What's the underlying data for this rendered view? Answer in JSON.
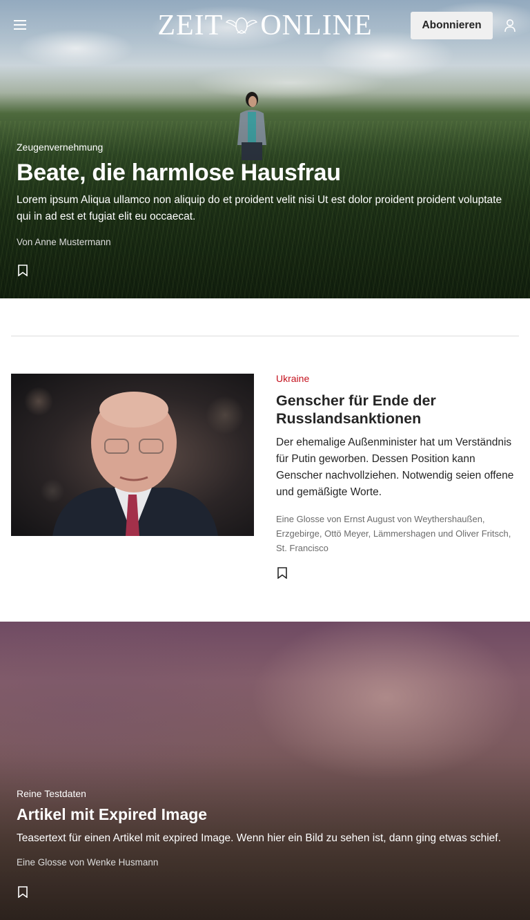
{
  "header": {
    "logo_left": "ZEIT",
    "logo_right": "ONLINE",
    "subscribe_label": "Abonnieren",
    "menu_icon": "hamburger-menu-icon",
    "account_icon": "user-account-icon"
  },
  "teasers": [
    {
      "kicker": "Zeugenvernehmung",
      "title": "Beate, die harmlose Hausfrau",
      "text": "Lorem ipsum Aliqua ullamco non aliquip do et proident velit nisi Ut est dolor proident proident voluptate qui in ad est et fugiat elit eu occaecat.",
      "byline": "Von Anne Mustermann",
      "bookmark_icon": "bookmark-icon"
    },
    {
      "kicker": "Ukraine",
      "title": "Genscher für Ende der Russlandsanktionen",
      "text": "Der ehemalige Außenminister hat um Verständnis für Putin geworben. Dessen Position kann Genscher nachvollziehen. Notwendig seien offene und gemäßigte Worte.",
      "byline": "Eine Glosse von Ernst August von Weythershaußen, Erzgebirge, Ottö Meyer, Lämmershagen und Oliver Fritsch, St. Francisco",
      "bookmark_icon": "bookmark-icon"
    },
    {
      "kicker": "Reine Testdaten",
      "title": "Artikel mit Expired Image",
      "text": "Teasertext für einen Artikel mit expired Image. Wenn hier ein Bild zu sehen ist, dann ging etwas schief.",
      "byline": "Eine Glosse von Wenke Husmann",
      "bookmark_icon": "bookmark-icon"
    }
  ],
  "colors": {
    "kicker_red": "#c4101c",
    "text": "#252525",
    "byline_gray": "#6b6b6b",
    "button_bg": "#f0f0f0"
  }
}
